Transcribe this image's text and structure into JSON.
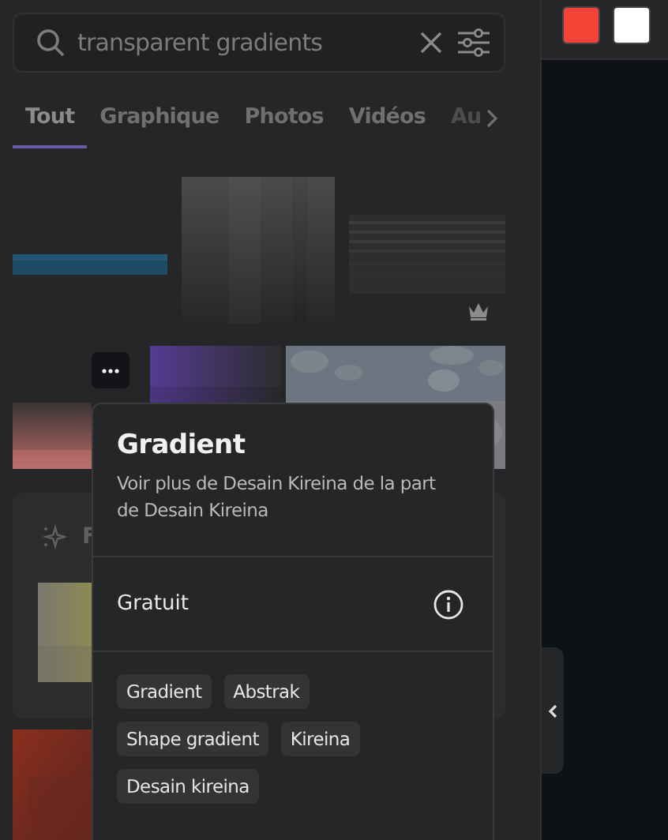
{
  "search": {
    "value": "transparent gradients"
  },
  "tabs": [
    {
      "label": "Tout",
      "selected": true
    },
    {
      "label": "Graphique",
      "selected": false
    },
    {
      "label": "Photos",
      "selected": false
    },
    {
      "label": "Vidéos",
      "selected": false
    },
    {
      "label": "Au",
      "selected": false
    }
  ],
  "swatches": [
    {
      "color": "#f44336"
    },
    {
      "color": "#ffffff"
    }
  ],
  "section": {
    "title": "F"
  },
  "popover": {
    "title": "Gradient",
    "description": "Voir plus de Desain Kireina de la part de Desain Kireina",
    "license": "Gratuit",
    "tags": [
      "Gradient",
      "Abstrak",
      "Shape gradient",
      "Kireina",
      "Desain kireina"
    ]
  }
}
